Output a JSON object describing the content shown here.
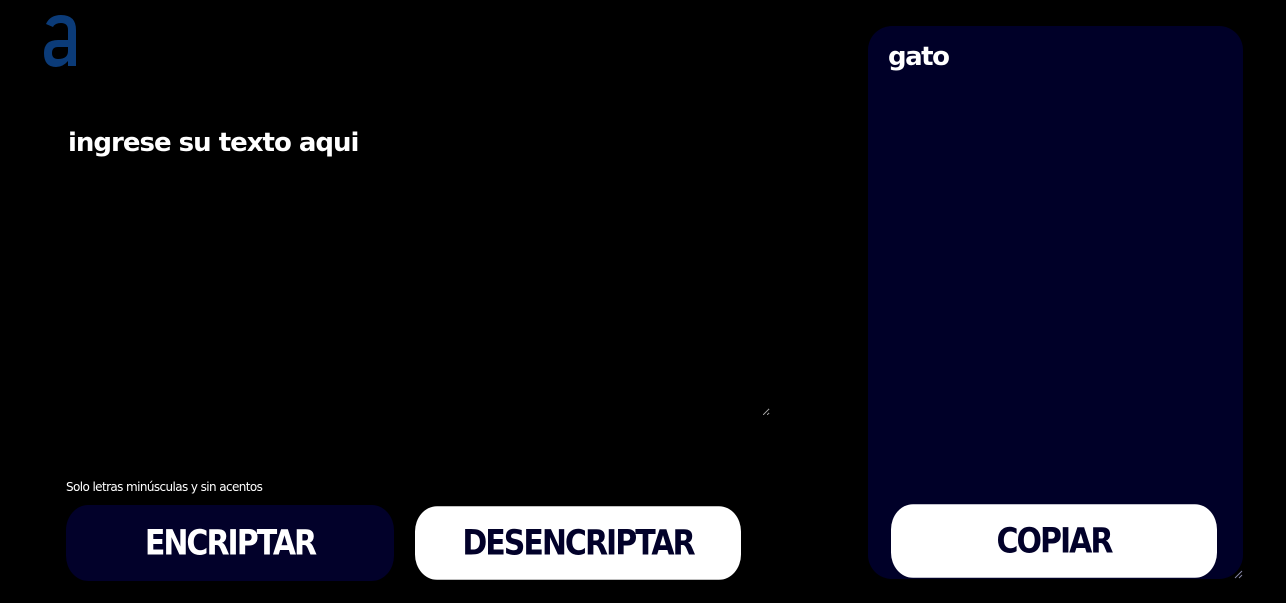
{
  "logo": {
    "icon": "alura-a-logo-icon",
    "color": "#0b3b78"
  },
  "input": {
    "placeholder": "ingrese su texto aqui",
    "value": ""
  },
  "hint": {
    "icon": "info-icon",
    "text": "Solo letras minúsculas y sin acentos"
  },
  "buttons": {
    "encrypt_label": "ENCRIPTAR",
    "decrypt_label": "DESENCRIPTAR",
    "copy_label": "COPIAR"
  },
  "output": {
    "text": "gato"
  },
  "colors": {
    "background": "#000000",
    "panel": "#000028",
    "primary_button": "#02012a",
    "secondary_button": "#ffffff",
    "text": "#ffffff",
    "logo": "#0b3b78"
  }
}
